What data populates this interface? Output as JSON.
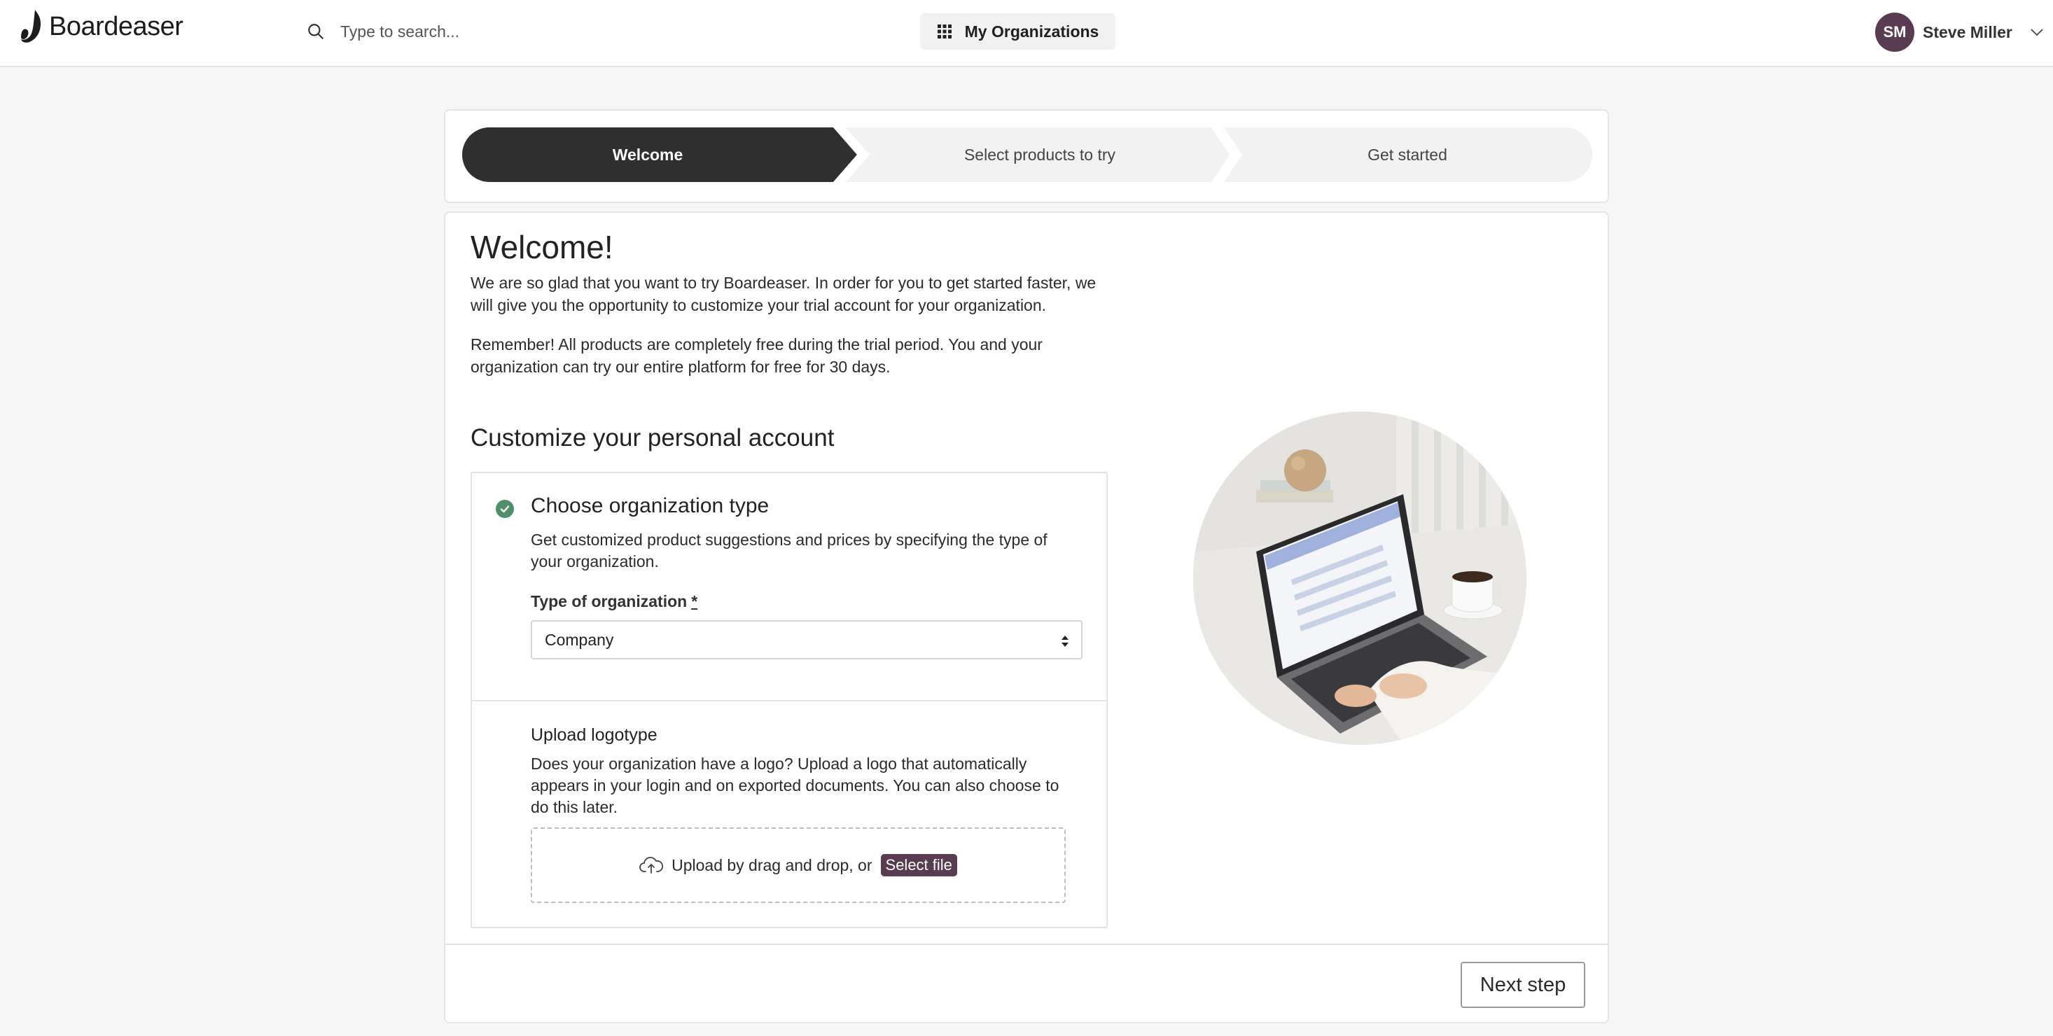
{
  "header": {
    "logo_text": "Boardeaser",
    "search_placeholder": "Type to search...",
    "org_button_label": "My Organizations",
    "user": {
      "initials": "SM",
      "name": "Steve Miller"
    },
    "icons": {
      "search": "search-icon",
      "grid": "grid-icon",
      "chevron": "chevron-down-icon"
    }
  },
  "stepper": {
    "steps": [
      {
        "label": "Welcome",
        "active": true
      },
      {
        "label": "Select products to try",
        "active": false
      },
      {
        "label": "Get started",
        "active": false
      }
    ]
  },
  "main": {
    "title": "Welcome!",
    "intro_1": "We are so glad that you want to try Boardeaser. In order for you to get started faster, we will give you the opportunity to customize your trial account for your organization.",
    "intro_2": "Remember! All products are completely free during the trial period. You and your organization can try our entire platform for free for 30 days.",
    "section_title": "Customize your personal account",
    "org_type": {
      "title": "Choose organization type",
      "description": "Get customized product suggestions and prices by specifying the type of your organization.",
      "field_label": "Type of organization",
      "required_mark": "*",
      "selected_value": "Company",
      "completed": true
    },
    "logo_upload": {
      "title": "Upload logotype",
      "description": "Does your organization have a logo? Upload a logo that automatically appears in your login and on exported documents. You can also choose to do this later.",
      "drop_text": "Upload by drag and drop, or",
      "select_file_label": "Select file"
    },
    "next_button_label": "Next step"
  },
  "colors": {
    "accent": "#5a3c52",
    "step_active": "#2f2f2f",
    "step_inactive": "#f2f2f2",
    "success": "#4f8f6b"
  }
}
